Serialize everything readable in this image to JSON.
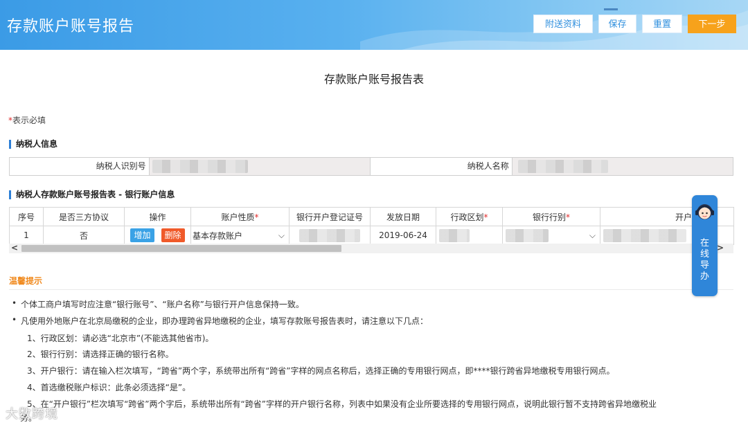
{
  "header": {
    "title": "存款账户账号报告",
    "buttons": {
      "attach": "附送资料",
      "save": "保存",
      "reset": "重置",
      "next": "下一步"
    }
  },
  "page_title": "存款账户账号报告表",
  "required_note": {
    "star": "*",
    "text": "表示必填"
  },
  "taxpayer_section": {
    "title": "纳税人信息",
    "id_label": "纳税人识别号",
    "name_label": "纳税人名称"
  },
  "bank_section": {
    "title": "纳税人存款账户账号报告表 - 银行账户信息",
    "columns": {
      "seq": "序号",
      "tripartite": "是否三方协议",
      "action": "操作",
      "acct_type": "账户性质",
      "bank_reg_no": "银行开户登记证号",
      "issue_date": "发放日期",
      "region": "行政区划",
      "bank_category": "银行行别",
      "open_bank": "开户"
    },
    "row": {
      "seq": "1",
      "tripartite": "否",
      "add": "增加",
      "del": "删除",
      "acct_type": "基本存款账户",
      "issue_date": "2019-06-24"
    }
  },
  "tips": {
    "title": "温馨提示",
    "b1": "个体工商户填写时应注意“银行账号”、“账户名称”与银行开户信息保持一致。",
    "b2": "凡使用外地账户在北京局缴税的企业，即办理跨省异地缴税的企业，填写存款账号报告表时，请注意以下几点：",
    "n1": "1、行政区划：请必选“北京市”(不能选其他省市)。",
    "n2": "2、银行行别：请选择正确的银行名称。",
    "n3": "3、开户银行：请在输入栏次填写，“跨省”两个字，系统带出所有“跨省”字样的网点名称后，选择正确的专用银行网点，即****银行跨省异地缴税专用银行网点。",
    "n4": "4、首选缴税账户标识：此条必须选择“是”。",
    "n5": "5、在“开户银行”栏次填写“跨省”两个字后，系统带出所有“跨省”字样的开户银行名称，列表中如果没有企业所要选择的专用银行网点，说明此银行暂不支持跨省异地缴税业",
    "n5b": "务。"
  },
  "helper": {
    "text": "在线导办"
  },
  "watermark": "大数跨境",
  "colors": {
    "primary": "#2f86d9",
    "accent": "#f7a21b",
    "danger": "#f05a2a",
    "required": "#e12a2a"
  }
}
